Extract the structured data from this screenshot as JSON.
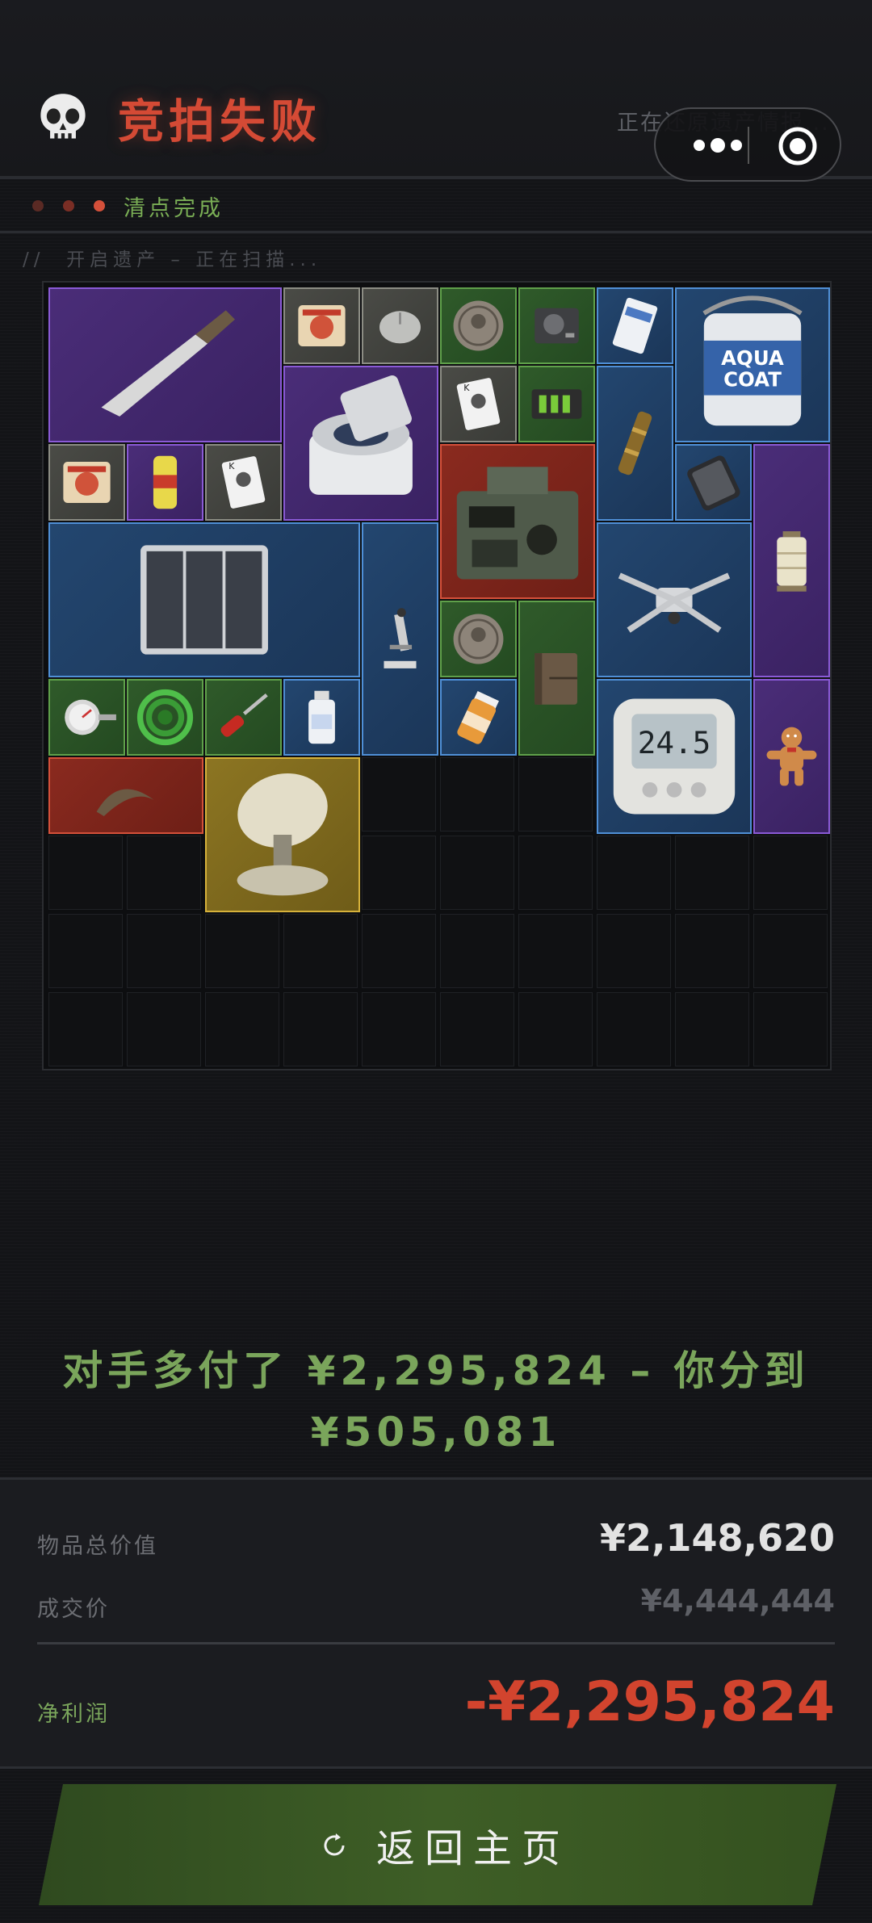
{
  "header": {
    "title": "竞拍失败",
    "restore_text": "正在还原遗产情报..."
  },
  "status": {
    "label": "清点完成",
    "dot_colors": [
      "#5a2a24",
      "#7a2e25",
      "#d4503a"
    ]
  },
  "scan_line": "//  开启遗产 – 正在扫描...",
  "inventory": {
    "columns": 10,
    "rows": 10,
    "items": [
      {
        "name": "knife",
        "rarity": "purple",
        "icon": "knife-icon"
      },
      {
        "name": "noodle-pack",
        "rarity": "gray",
        "icon": "noodle-pack-icon"
      },
      {
        "name": "mouse",
        "rarity": "gray",
        "icon": "mouse-icon"
      },
      {
        "name": "coin",
        "rarity": "green",
        "icon": "coin-icon"
      },
      {
        "name": "hard-drive",
        "rarity": "green",
        "icon": "hard-drive-icon"
      },
      {
        "name": "card-box",
        "rarity": "blue",
        "icon": "card-box-icon"
      },
      {
        "name": "paint-can",
        "rarity": "blue",
        "icon": "paint-can-icon",
        "label_line1": "AQUA",
        "label_line2": "COAT"
      },
      {
        "name": "centrifuge",
        "rarity": "purple",
        "icon": "centrifuge-icon"
      },
      {
        "name": "playing-card",
        "rarity": "gray",
        "icon": "playing-card-icon"
      },
      {
        "name": "battery-pack",
        "rarity": "green",
        "icon": "battery-pack-icon"
      },
      {
        "name": "spyglass",
        "rarity": "blue",
        "icon": "spyglass-icon"
      },
      {
        "name": "noodle-pack-2",
        "rarity": "gray",
        "icon": "noodle-pack-icon"
      },
      {
        "name": "soda-can",
        "rarity": "purple",
        "icon": "soda-can-icon"
      },
      {
        "name": "playing-card-2",
        "rarity": "gray",
        "icon": "playing-card-icon"
      },
      {
        "name": "radio",
        "rarity": "red",
        "icon": "radio-icon"
      },
      {
        "name": "phone",
        "rarity": "blue",
        "icon": "phone-icon"
      },
      {
        "name": "lantern",
        "rarity": "purple",
        "icon": "lantern-icon"
      },
      {
        "name": "solar-panel",
        "rarity": "blue",
        "icon": "solar-panel-icon"
      },
      {
        "name": "microscope",
        "rarity": "blue",
        "icon": "microscope-icon"
      },
      {
        "name": "drone",
        "rarity": "blue",
        "icon": "drone-icon"
      },
      {
        "name": "coin-2",
        "rarity": "green",
        "icon": "coin-icon"
      },
      {
        "name": "journal",
        "rarity": "green",
        "icon": "journal-icon"
      },
      {
        "name": "gauge",
        "rarity": "green",
        "icon": "gauge-icon"
      },
      {
        "name": "hose",
        "rarity": "green",
        "icon": "hose-icon"
      },
      {
        "name": "screwdriver",
        "rarity": "green",
        "icon": "screwdriver-icon"
      },
      {
        "name": "medicine-bottle",
        "rarity": "blue",
        "icon": "medicine-bottle-icon"
      },
      {
        "name": "pill-bottle",
        "rarity": "blue",
        "icon": "pill-bottle-icon"
      },
      {
        "name": "thermometer",
        "rarity": "blue",
        "icon": "thermometer-icon",
        "display": "24.5"
      },
      {
        "name": "gingerbread",
        "rarity": "purple",
        "icon": "gingerbread-icon"
      },
      {
        "name": "claw",
        "rarity": "red",
        "icon": "claw-icon"
      },
      {
        "name": "satellite-dish",
        "rarity": "gold",
        "icon": "satellite-dish-icon"
      }
    ]
  },
  "result": {
    "message": "对手多付了 ¥2,295,824 – 你分到 ¥505,081"
  },
  "summary": {
    "total_value_label": "物品总价值",
    "total_value": "¥2,148,620",
    "deal_price_label": "成交价",
    "deal_price": "¥4,444,444",
    "net_profit_label": "净利润",
    "net_profit": "-¥2,295,824"
  },
  "home_button": {
    "label": "返回主页"
  },
  "colors": {
    "failure_red": "#d44a35",
    "success_green": "#7aa55b",
    "net_loss_red": "#d2442e"
  }
}
